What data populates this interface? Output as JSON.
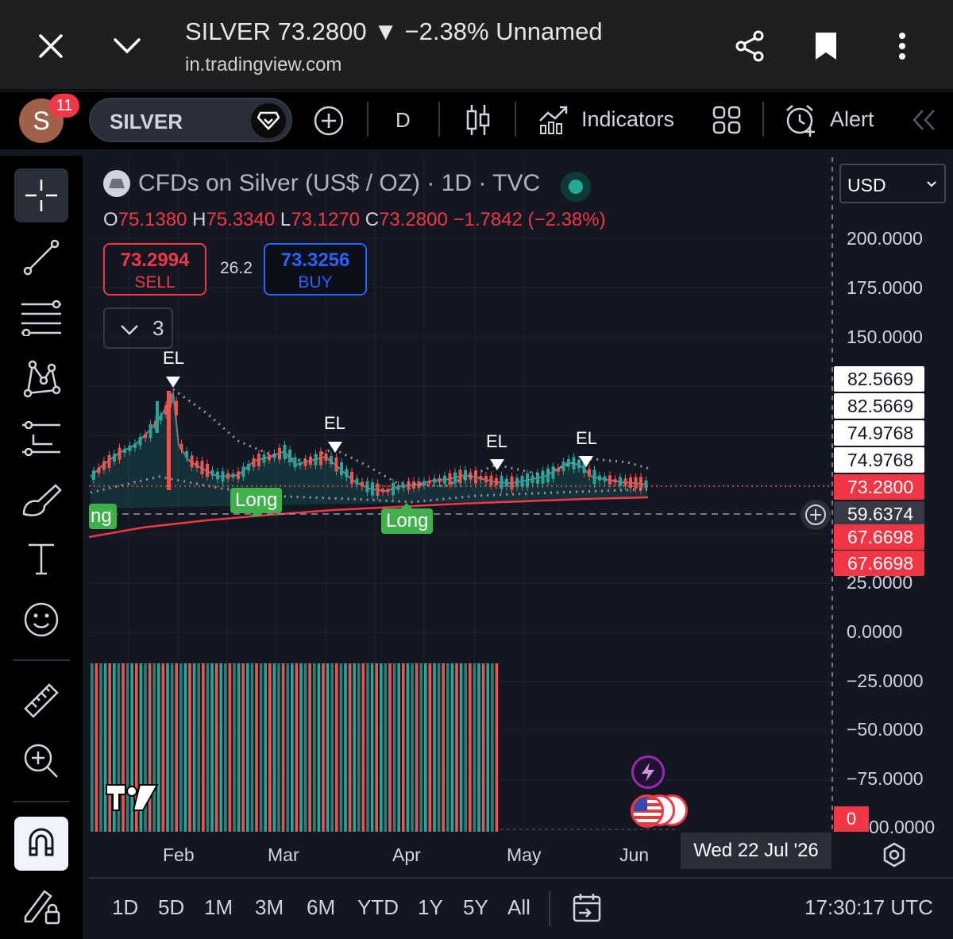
{
  "browser": {
    "title": "SILVER 73.2800 ▼ −2.38% Unnamed",
    "url": "in.tradingview.com",
    "close_icon": "close-icon",
    "minimize_icon": "chevron-down-icon",
    "share_icon": "share-icon",
    "bookmark_icon": "bookmark-icon",
    "menu_icon": "more-vertical-icon"
  },
  "toolbar": {
    "avatar_letter": "S",
    "notification_count": "11",
    "symbol": "SILVER",
    "interval": "D",
    "indicators_label": "Indicators",
    "alert_label": "Alert"
  },
  "legend": {
    "name": "CFDs on Silver (US$ / OZ) · 1D · TVC",
    "o_label": "O",
    "o_value": "75.1380",
    "h_label": "H",
    "h_value": "75.3340",
    "l_label": "L",
    "l_value": "73.1270",
    "c_label": "C",
    "c_value": "73.2800",
    "change": "−1.7842 (−2.38%)",
    "sell_price": "73.2994",
    "sell_label": "SELL",
    "spread": "26.2",
    "buy_price": "73.3256",
    "buy_label": "BUY",
    "indicator_count": "3"
  },
  "currency": "USD",
  "y_axis_ticks": [
    "200.0000",
    "175.0000",
    "150.0000",
    "25.0000",
    "0.0000",
    "−25.0000",
    "−50.0000",
    "−75.0000",
    "00.0000"
  ],
  "price_labels": [
    {
      "value": "82.5669",
      "bg": "#ffffff",
      "fg": "#131722"
    },
    {
      "value": "82.5669",
      "bg": "#ffffff",
      "fg": "#131722"
    },
    {
      "value": "74.9768",
      "bg": "#ffffff",
      "fg": "#131722"
    },
    {
      "value": "74.9768",
      "bg": "#ffffff",
      "fg": "#131722"
    },
    {
      "value": "73.2800",
      "bg": "#f23645",
      "fg": "#ffffff"
    },
    {
      "value": "59.6374",
      "bg": "#363a45",
      "fg": "#ffffff"
    },
    {
      "value": "67.6698",
      "bg": "#f23645",
      "fg": "#ffffff"
    },
    {
      "value": "67.6698",
      "bg": "#f23645",
      "fg": "#ffffff"
    }
  ],
  "volume_label": "0",
  "x_axis_ticks": [
    "Feb",
    "Mar",
    "Apr",
    "May",
    "Jun"
  ],
  "crosshair_date": "Wed 22 Jul '26",
  "signals": {
    "el": "EL",
    "long": "Long",
    "long_partial": "ng"
  },
  "ranges": [
    "1D",
    "5D",
    "1M",
    "3M",
    "6M",
    "YTD",
    "1Y",
    "5Y",
    "All"
  ],
  "time": "17:30:17 UTC",
  "colors": {
    "up": "#26a69a",
    "down": "#ef5350",
    "long": "#3fb04a",
    "ma": "#f23645"
  }
}
